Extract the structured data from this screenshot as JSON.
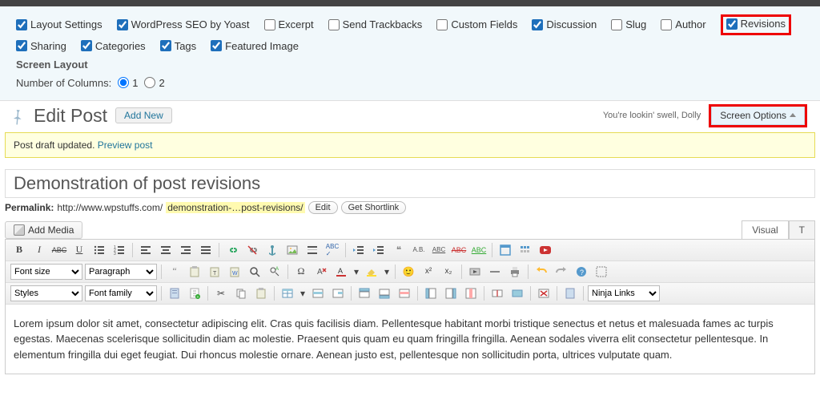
{
  "screenOptions": {
    "checkboxes": [
      {
        "label": "Layout Settings",
        "checked": true
      },
      {
        "label": "WordPress SEO by Yoast",
        "checked": true
      },
      {
        "label": "Excerpt",
        "checked": false
      },
      {
        "label": "Send Trackbacks",
        "checked": false
      },
      {
        "label": "Custom Fields",
        "checked": false
      },
      {
        "label": "Discussion",
        "checked": true
      },
      {
        "label": "Slug",
        "checked": false
      },
      {
        "label": "Author",
        "checked": false
      },
      {
        "label": "Revisions",
        "checked": true,
        "highlight": true
      },
      {
        "label": "Sharing",
        "checked": true
      },
      {
        "label": "Categories",
        "checked": true
      },
      {
        "label": "Tags",
        "checked": true
      },
      {
        "label": "Featured Image",
        "checked": true
      }
    ],
    "layoutHeading": "Screen Layout",
    "columnsLabel": "Number of Columns:",
    "columns": [
      {
        "label": "1",
        "selected": true
      },
      {
        "label": "2",
        "selected": false
      }
    ]
  },
  "header": {
    "title": "Edit Post",
    "addNew": "Add New",
    "dolly": "You're lookin' swell, Dolly",
    "screenOptionsTab": "Screen Options"
  },
  "notice": {
    "text": "Post draft updated. ",
    "link": "Preview post"
  },
  "post": {
    "title": "Demonstration of post revisions",
    "permalinkLabel": "Permalink:",
    "permalinkBase": "http://www.wpstuffs.com/",
    "permalinkSlug": "demonstration-…post-revisions/",
    "editBtn": "Edit",
    "shortlinkBtn": "Get Shortlink",
    "addMedia": "Add Media",
    "visualTab": "Visual",
    "textTab": "T",
    "content": "Lorem ipsum dolor sit amet, consectetur adipiscing elit. Cras quis facilisis diam. Pellentesque habitant morbi tristique senectus et netus et malesuada fames ac turpis egestas. Maecenas scelerisque sollicitudin diam ac molestie. Praesent quis quam eu quam fringilla fringilla. Aenean sodales viverra elit consectetur pellentesque. In elementum fringilla dui eget feugiat. Dui rhoncus molestie ornare. Aenean justo est, pellentesque non sollicitudin porta, ultrices vulputate quam."
  },
  "toolbar": {
    "row1": {
      "bold": "B",
      "italic": "I",
      "strike": "ABC",
      "underline": "U",
      "ninjaLabel": "Ninja Links"
    },
    "selects": {
      "fontSize": "Font size",
      "paragraph": "Paragraph",
      "styles": "Styles",
      "fontFamily": "Font family"
    }
  }
}
